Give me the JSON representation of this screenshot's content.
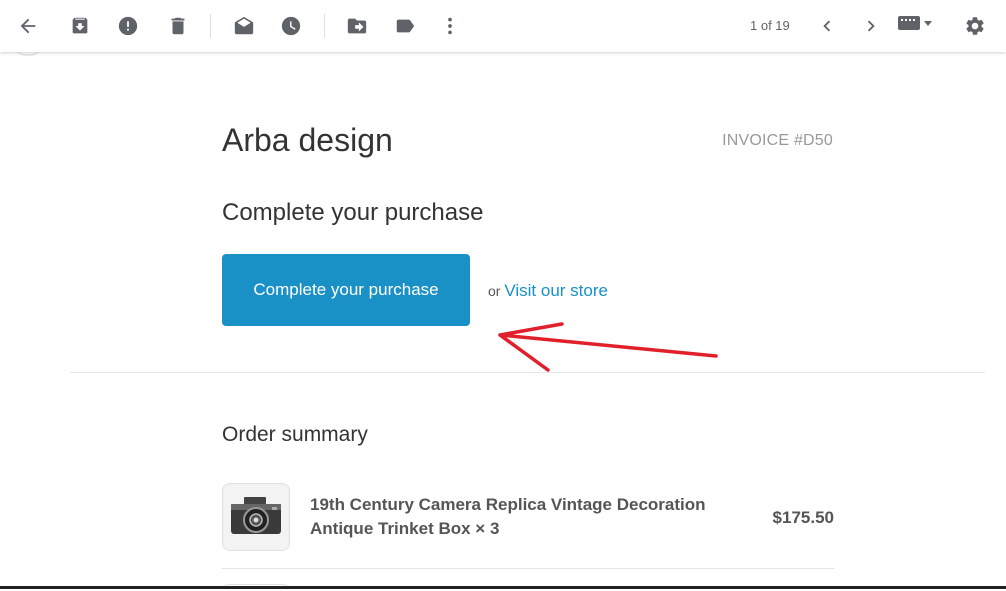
{
  "toolbar": {
    "icons": [
      "back-arrow-icon",
      "archive-icon",
      "report-spam-icon",
      "delete-icon",
      "mark-unread-icon",
      "snooze-icon",
      "move-to-icon",
      "label-icon",
      "more-vert-icon"
    ],
    "pager": "1 of 19"
  },
  "email": {
    "brand": "Arba design",
    "invoice": "INVOICE #D50",
    "heading": "Complete your purchase",
    "cta_label": "Complete your purchase",
    "or_text": "or",
    "store_link": "Visit our store",
    "order_summary": "Order summary",
    "items": [
      {
        "name": "19th Century Camera Replica Vintage Decoration Antique Trinket Box × 3",
        "price": "$175.50"
      }
    ]
  },
  "colors": {
    "accent": "#1990c6",
    "annotation": "#e0202a"
  }
}
